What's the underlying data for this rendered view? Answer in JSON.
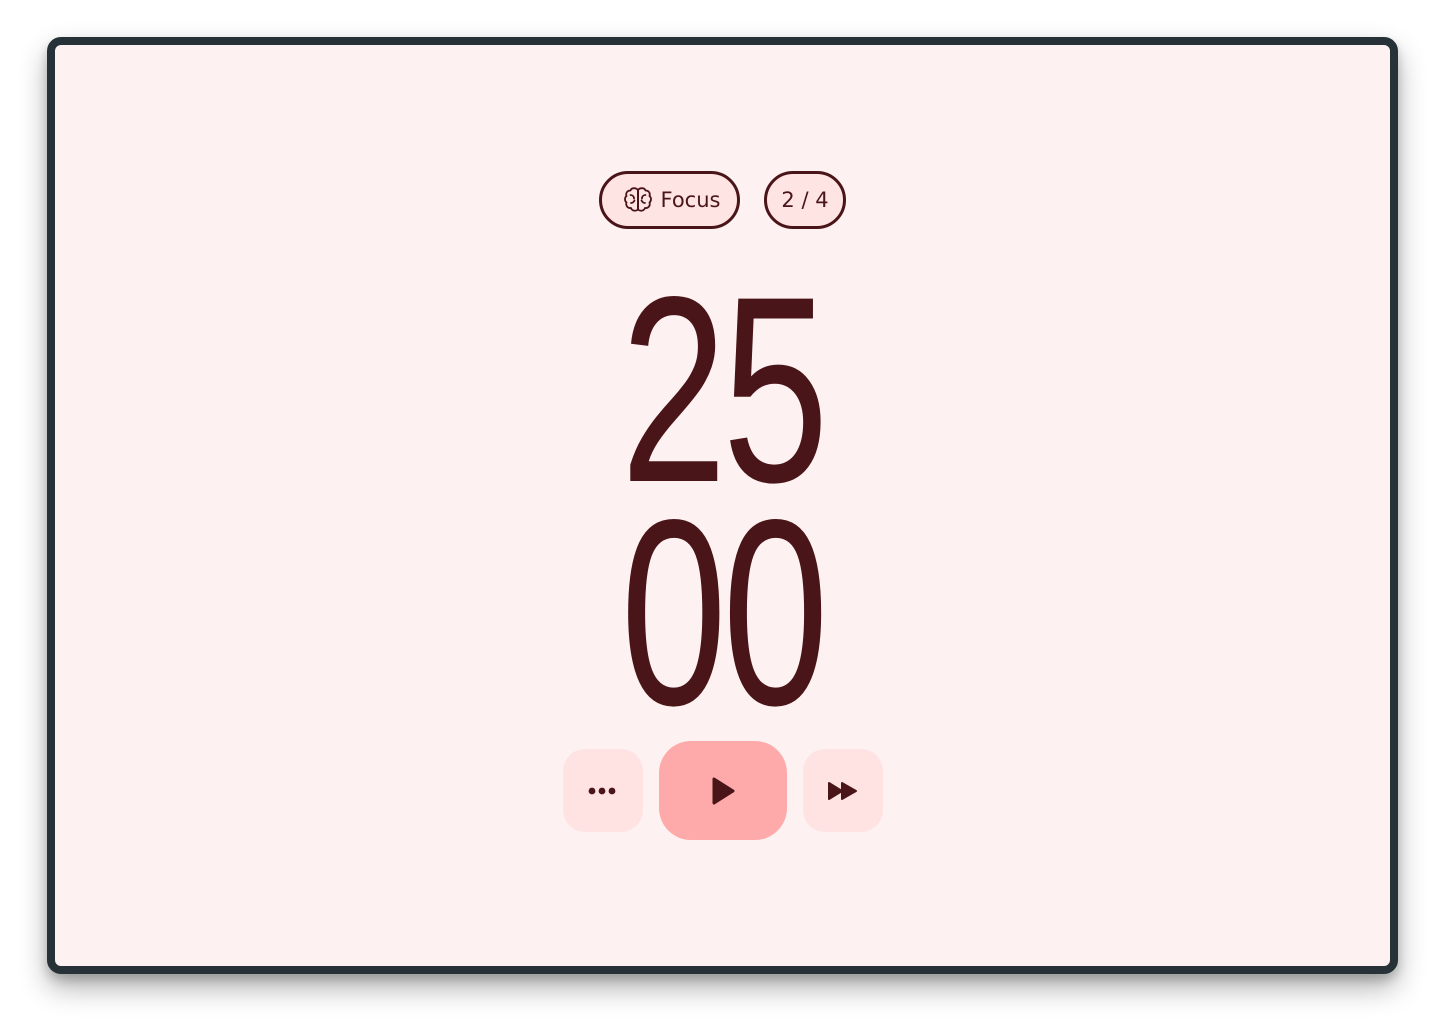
{
  "timer": {
    "mode_label": "Focus",
    "session_count": "2 / 4",
    "minutes": "25",
    "seconds": "00"
  },
  "controls": {
    "more_icon": "more-horizontal-icon",
    "play_icon": "play-icon",
    "skip_icon": "fast-forward-icon"
  },
  "colors": {
    "background": "#fdf1f1",
    "frame_border": "#263238",
    "text": "#4a1518",
    "chip_fill": "#ffe4e4",
    "primary_button": "#ffaaaa",
    "secondary_button": "#ffe3e3"
  }
}
